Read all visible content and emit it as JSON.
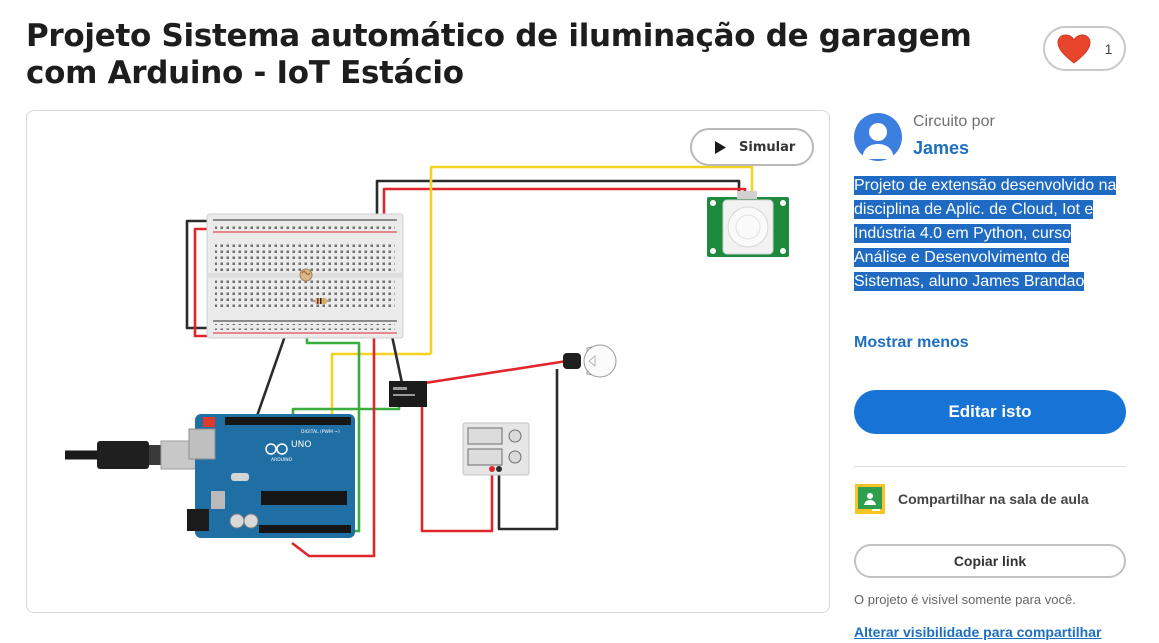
{
  "project": {
    "title": "Projeto Sistema automático de iluminação de garagem com Arduino - IoT Estácio",
    "likes": "1"
  },
  "toolbar": {
    "simulate_label": "Simular"
  },
  "author": {
    "label": "Circuito por",
    "name": "James",
    "description": "Projeto de extensão desenvolvido na disciplina de Aplic. de Cloud, Iot e Indústria 4.0 em Python, curso Análise e Desenvolvimento de Sistemas, aluno James Brandao"
  },
  "actions": {
    "show_less": "Mostrar menos",
    "edit": "Editar isto",
    "share_classroom": "Compartilhar na sala de aula",
    "copy_link": "Copiar link",
    "visibility_note": "O projeto é visível somente para você.",
    "visibility_link": "Alterar visibilidade para compartilhar"
  },
  "circuit": {
    "board_brand": "ARDUINO",
    "board_model": "UNO",
    "digital_label": "DIGITAL (PWM ~)"
  },
  "colors": {
    "accent": "#1773d6",
    "link": "#1e6fc0",
    "heart": "#e8452c",
    "arduino": "#1f6fa5",
    "pir_board": "#1e8a3e",
    "wire_red": "#e0262b",
    "wire_black": "#2b2b2b",
    "wire_yellow": "#f3d321",
    "wire_green": "#3cae3f"
  }
}
